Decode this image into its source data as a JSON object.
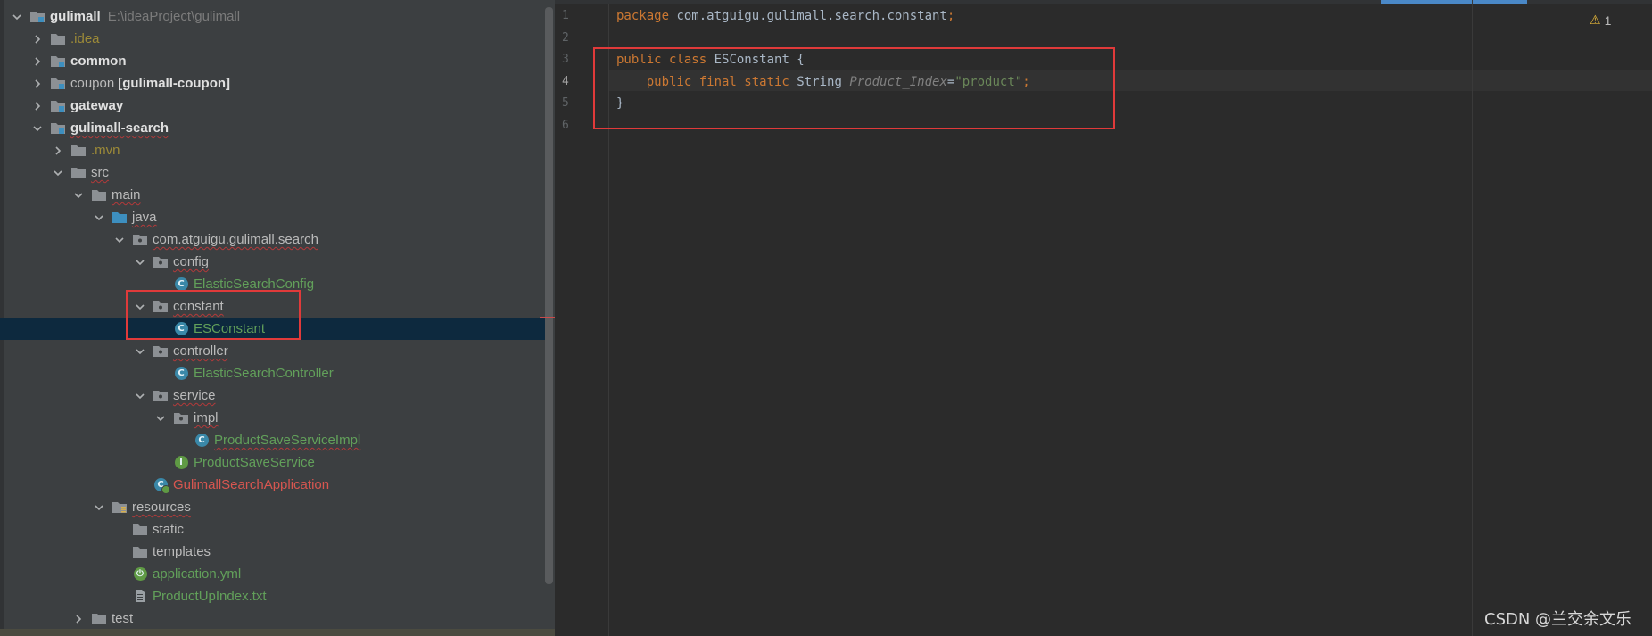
{
  "tree": {
    "rows": [
      {
        "label": "gulimall",
        "suffix": "E:\\ideaProject\\gulimall",
        "style": "bold",
        "icon": "module-folder-icon",
        "arrow": "down",
        "depth": 0
      },
      {
        "label": ".idea",
        "style": "yellow",
        "icon": "folder-icon",
        "arrow": "right",
        "depth": 1
      },
      {
        "label": "common",
        "style": "bold",
        "icon": "module-folder-icon",
        "arrow": "right",
        "depth": 1
      },
      {
        "label": "coupon",
        "suffix": "[gulimall-coupon]",
        "style": "default",
        "icon": "module-folder-icon",
        "arrow": "right",
        "depth": 1
      },
      {
        "label": "gateway",
        "style": "bold",
        "icon": "module-folder-icon",
        "arrow": "right",
        "depth": 1
      },
      {
        "label": "gulimall-search",
        "style": "bold",
        "icon": "module-folder-icon",
        "arrow": "down",
        "depth": 1
      },
      {
        "label": ".mvn",
        "style": "yellow",
        "icon": "folder-icon",
        "arrow": "right",
        "depth": 2
      },
      {
        "label": "src",
        "style": "default",
        "icon": "folder-icon",
        "arrow": "down",
        "depth": 2
      },
      {
        "label": "main",
        "style": "default",
        "icon": "folder-icon",
        "arrow": "down",
        "depth": 3
      },
      {
        "label": "java",
        "style": "default",
        "icon": "source-folder-icon",
        "arrow": "down",
        "depth": 4
      },
      {
        "label": "com.atguigu.gulimall.search",
        "style": "default",
        "icon": "package-icon",
        "arrow": "down",
        "depth": 5
      },
      {
        "label": "config",
        "style": "default",
        "icon": "package-icon",
        "arrow": "down",
        "depth": 6
      },
      {
        "label": "ElasticSearchConfig",
        "style": "green",
        "icon": "class-icon",
        "arrow": "",
        "depth": 7
      },
      {
        "label": "constant",
        "style": "default",
        "icon": "package-icon",
        "arrow": "down",
        "depth": 6
      },
      {
        "label": "ESConstant",
        "style": "green",
        "icon": "class-icon",
        "arrow": "",
        "depth": 7,
        "selected": true
      },
      {
        "label": "controller",
        "style": "default",
        "icon": "package-icon",
        "arrow": "down",
        "depth": 6
      },
      {
        "label": "ElasticSearchController",
        "style": "green",
        "icon": "class-icon",
        "arrow": "",
        "depth": 7
      },
      {
        "label": "service",
        "style": "default",
        "icon": "package-icon",
        "arrow": "down",
        "depth": 6
      },
      {
        "label": "impl",
        "style": "default",
        "icon": "package-icon",
        "arrow": "down",
        "depth": 7
      },
      {
        "label": "ProductSaveServiceImpl",
        "style": "green",
        "icon": "class-icon",
        "arrow": "",
        "depth": 8
      },
      {
        "label": "ProductSaveService",
        "style": "green",
        "icon": "interface-icon",
        "arrow": "",
        "depth": 7
      },
      {
        "label": "GulimallSearchApplication",
        "style": "red",
        "icon": "spring-boot-class-icon",
        "arrow": "",
        "depth": 6
      },
      {
        "label": "resources",
        "style": "default",
        "icon": "resources-folder-icon",
        "arrow": "down",
        "depth": 4
      },
      {
        "label": "static",
        "style": "default",
        "icon": "folder-icon",
        "arrow": "",
        "depth": 5
      },
      {
        "label": "templates",
        "style": "default",
        "icon": "folder-icon",
        "arrow": "",
        "depth": 5
      },
      {
        "label": "application.yml",
        "style": "green",
        "icon": "spring-yml-icon",
        "arrow": "",
        "depth": 5
      },
      {
        "label": "ProductUpIndex.txt",
        "style": "green",
        "icon": "text-file-icon",
        "arrow": "",
        "depth": 5
      },
      {
        "label": "test",
        "style": "default",
        "icon": "folder-icon",
        "arrow": "right",
        "depth": 3
      }
    ],
    "badge_class": "C",
    "badge_interface": "I"
  },
  "editor": {
    "line_numbers": [
      "1",
      "2",
      "3",
      "4",
      "5",
      "6"
    ],
    "lines": [
      [
        {
          "t": "package",
          "c": "kw"
        },
        {
          "t": " com.atguigu.gulimall.search.constant",
          "c": ""
        },
        {
          "t": ";",
          "c": "kw"
        }
      ],
      [],
      [
        {
          "t": "public class",
          "c": "kw"
        },
        {
          "t": " ESConstant {",
          "c": ""
        }
      ],
      [
        {
          "t": "    public final static",
          "c": "kw"
        },
        {
          "t": " String ",
          "c": ""
        },
        {
          "t": "Product_Index",
          "c": "ital"
        },
        {
          "t": "=",
          "c": ""
        },
        {
          "t": "\"product\"",
          "c": "str"
        },
        {
          "t": ";",
          "c": "kw"
        }
      ],
      [
        {
          "t": "}",
          "c": ""
        }
      ],
      []
    ],
    "warnings_count": "1"
  },
  "watermark": "CSDN @兰交余文乐",
  "colors": {
    "background": "#2b2b2b",
    "tree_bg": "#3c3f41",
    "selection": "#0d293e",
    "annotation_red": "#e03a3a"
  }
}
